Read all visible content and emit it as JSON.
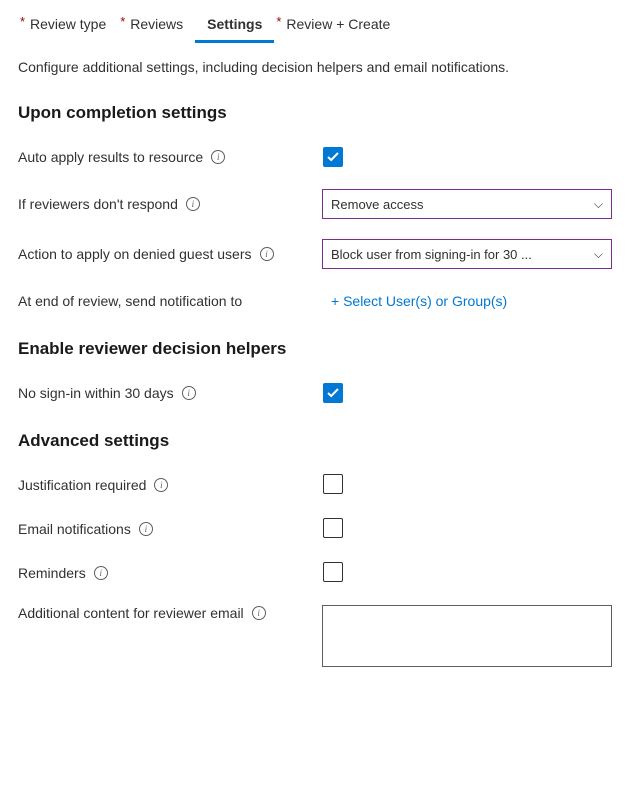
{
  "tabs": {
    "review_type": "Review type",
    "reviews": "Reviews",
    "settings": "Settings",
    "review_create": "Review + Create"
  },
  "intro": "Configure additional settings, including decision helpers and email notifications.",
  "sections": {
    "completion": "Upon completion settings",
    "helpers": "Enable reviewer decision helpers",
    "advanced": "Advanced settings"
  },
  "labels": {
    "auto_apply": "Auto apply results to resource",
    "no_respond": "If reviewers don't respond",
    "denied_guest": "Action to apply on denied guest users",
    "end_notify": "At end of review, send notification to",
    "no_signin": "No sign-in within 30 days",
    "justification": "Justification required",
    "email_notif": "Email notifications",
    "reminders": "Reminders",
    "additional_content": "Additional content for reviewer email"
  },
  "values": {
    "no_respond_selected": "Remove access",
    "denied_guest_selected": "Block user from signing-in for 30 ...",
    "select_users_link": "+ Select User(s) or Group(s)",
    "additional_content_text": ""
  },
  "checked": {
    "auto_apply": true,
    "no_signin": true,
    "justification": false,
    "email_notif": false,
    "reminders": false
  }
}
